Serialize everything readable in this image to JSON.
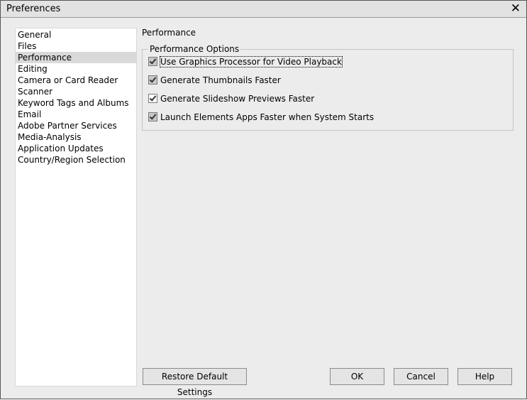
{
  "window": {
    "title": "Preferences"
  },
  "nav": {
    "items": [
      "General",
      "Files",
      "Performance",
      "Editing",
      "Camera or Card Reader",
      "Scanner",
      "Keyword Tags and Albums",
      "Email",
      "Adobe Partner Services",
      "Media-Analysis",
      "Application Updates",
      "Country/Region Selection"
    ],
    "selected": "Performance"
  },
  "panel": {
    "heading": "Performance",
    "group_label": "Performance Options",
    "options": [
      {
        "label": "Use Graphics Processor for Video Playback",
        "checked": true,
        "enabled": false
      },
      {
        "label": "Generate Thumbnails Faster",
        "checked": true,
        "enabled": false
      },
      {
        "label": "Generate Slideshow Previews Faster",
        "checked": true,
        "enabled": true
      },
      {
        "label": "Launch Elements Apps Faster when System Starts",
        "checked": true,
        "enabled": false
      }
    ]
  },
  "buttons": {
    "restore": "Restore Default Settings",
    "ok": "OK",
    "cancel": "Cancel",
    "help": "Help"
  }
}
